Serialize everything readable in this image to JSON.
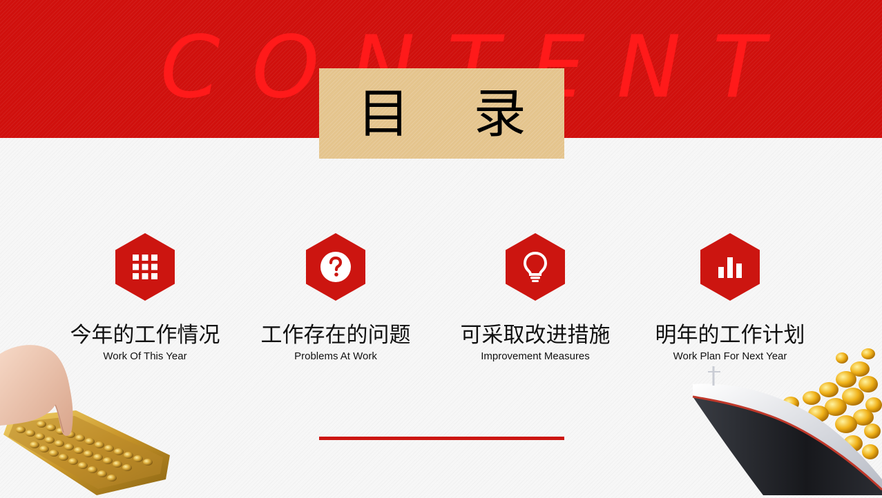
{
  "header": {
    "watermark": "CONTENT",
    "title": "目 录"
  },
  "items": [
    {
      "icon": "grid-icon",
      "title": "今年的工作情况",
      "subtitle": "Work Of This Year"
    },
    {
      "icon": "question-icon",
      "title": "工作存在的问题",
      "subtitle": "Problems At Work"
    },
    {
      "icon": "lightbulb-icon",
      "title": "可采取改进措施",
      "subtitle": "Improvement Measures"
    },
    {
      "icon": "bar-chart-icon",
      "title": "明年的工作计划",
      "subtitle": "Work Plan For Next Year"
    }
  ],
  "colors": {
    "brand_red": "#cc1510",
    "band_red": "#d0100d",
    "gold": "#e4c48d"
  }
}
